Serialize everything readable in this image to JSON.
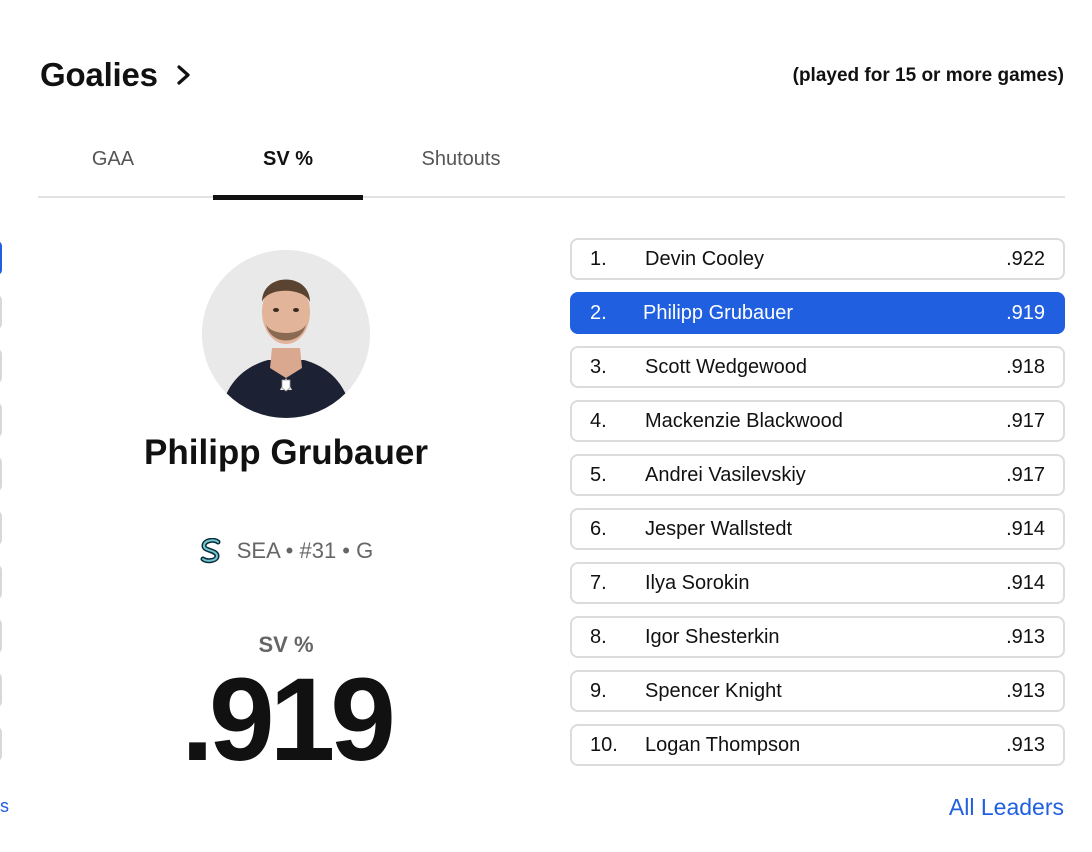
{
  "header": {
    "title": "Goalies",
    "qualifier": "(played for 15 or more games)"
  },
  "tabs": [
    {
      "label": "GAA",
      "active": false
    },
    {
      "label": "SV %",
      "active": true
    },
    {
      "label": "Shutouts",
      "active": false
    }
  ],
  "featured": {
    "name": "Philipp Grubauer",
    "team_line": "SEA • #31 • G",
    "stat_label": "SV %",
    "stat_value": ".919"
  },
  "leaders": [
    {
      "rank": "1.",
      "name": "Devin Cooley",
      "value": ".922"
    },
    {
      "rank": "2.",
      "name": "Philipp Grubauer",
      "value": ".919"
    },
    {
      "rank": "3.",
      "name": "Scott Wedgewood",
      "value": ".918"
    },
    {
      "rank": "4.",
      "name": "Mackenzie Blackwood",
      "value": ".917"
    },
    {
      "rank": "5.",
      "name": "Andrei Vasilevskiy",
      "value": ".917"
    },
    {
      "rank": "6.",
      "name": "Jesper Wallstedt",
      "value": ".914"
    },
    {
      "rank": "7.",
      "name": "Ilya Sorokin",
      "value": ".914"
    },
    {
      "rank": "8.",
      "name": "Igor Shesterkin",
      "value": ".913"
    },
    {
      "rank": "9.",
      "name": "Spencer Knight",
      "value": ".913"
    },
    {
      "rank": "10.",
      "name": "Logan Thompson",
      "value": ".913"
    }
  ],
  "all_leaders_label": "All Leaders",
  "edge_glyph": "s",
  "colors": {
    "accent": "#1f5fe0",
    "text": "#111111",
    "muted": "#666666",
    "border": "#dcdcdc",
    "team_logo": "#3c8a93"
  },
  "icons": {
    "header_chevron": "chevron-right-icon",
    "team_logo": "kraken-logo-icon"
  }
}
